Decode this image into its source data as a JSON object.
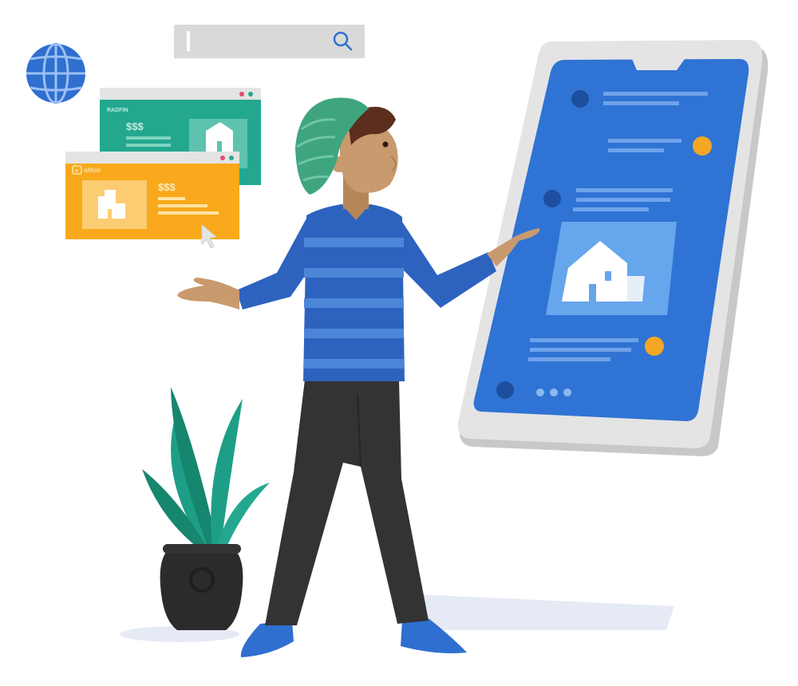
{
  "search_bar": {
    "value": "",
    "placeholder": "",
    "icon": "search-icon"
  },
  "globe": {
    "icon": "globe-icon"
  },
  "back_window": {
    "brand": "RADFIN",
    "price": "$$$",
    "color": "#23A88F"
  },
  "front_window": {
    "brand": "willow",
    "brand_mark": "w",
    "price": "$$$",
    "color": "#F9A91B"
  },
  "phone": {
    "screen_color": "#2F73D4",
    "body_color": "#E4E4E4",
    "accent_color": "#F5A623",
    "icons": [
      "house-icon"
    ]
  },
  "cursor": {
    "icon": "pointer-arrow-icon"
  },
  "plant": {
    "leaf_color": "#1E9E86",
    "pot_color": "#2B2B2B"
  },
  "person": {
    "hat_color": "#3FA57E",
    "sweater_color": "#2D63BF",
    "pants_color": "#333333"
  }
}
